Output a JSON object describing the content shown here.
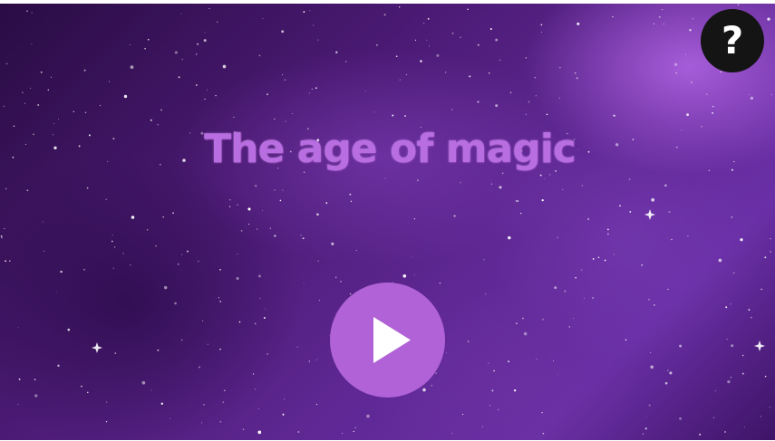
{
  "game": {
    "title": "The age of magic",
    "help_label": "?",
    "play_icon": "play-icon"
  },
  "colors": {
    "title": "#b86ee0",
    "play_button": "#b062d6",
    "help_button": "#141414",
    "background": "#4a1a73"
  }
}
